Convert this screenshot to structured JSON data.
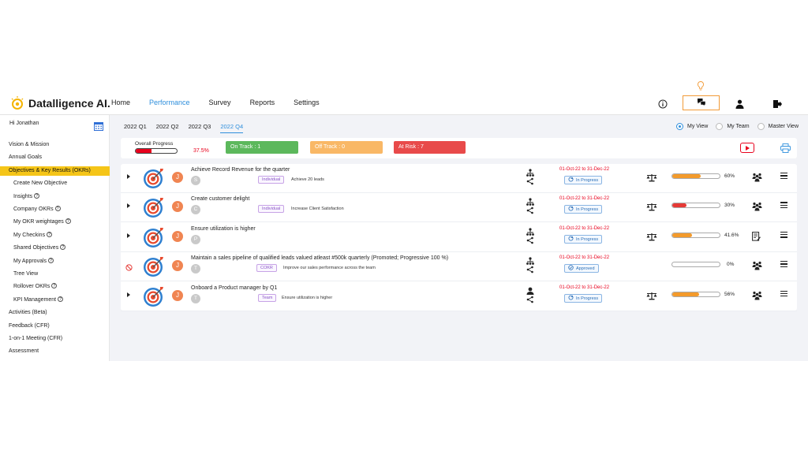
{
  "app": {
    "brand": "Datalligence AI.",
    "nav": [
      "Home",
      "Performance",
      "Survey",
      "Reports",
      "Settings"
    ],
    "active_nav": "Performance"
  },
  "sidebar": {
    "greeting": "Hi Jonathan",
    "items": [
      {
        "label": "Vision & Mission",
        "sub": false,
        "help": false,
        "active": false
      },
      {
        "label": "Annual Goals",
        "sub": false,
        "help": false,
        "active": false
      },
      {
        "label": "Objectives & Key Results (OKRs)",
        "sub": false,
        "help": false,
        "active": true
      },
      {
        "label": "Create New Objective",
        "sub": true,
        "help": false,
        "active": false
      },
      {
        "label": "Insights",
        "sub": true,
        "help": true,
        "active": false
      },
      {
        "label": "Company OKRs",
        "sub": true,
        "help": true,
        "active": false
      },
      {
        "label": "My OKR weightages",
        "sub": true,
        "help": true,
        "active": false
      },
      {
        "label": "My Checkins",
        "sub": true,
        "help": true,
        "active": false
      },
      {
        "label": "Shared Objectives",
        "sub": true,
        "help": true,
        "active": false
      },
      {
        "label": "My Approvals",
        "sub": true,
        "help": true,
        "active": false
      },
      {
        "label": "Tree View",
        "sub": true,
        "help": false,
        "active": false
      },
      {
        "label": "Rollover OKRs",
        "sub": true,
        "help": true,
        "active": false
      },
      {
        "label": "KPI Management",
        "sub": true,
        "help": true,
        "active": false
      },
      {
        "label": "Activities (Beta)",
        "sub": false,
        "help": false,
        "active": false
      },
      {
        "label": "Feedback (CFR)",
        "sub": false,
        "help": false,
        "active": false
      },
      {
        "label": "1-on-1 Meeting (CFR)",
        "sub": false,
        "help": false,
        "active": false
      },
      {
        "label": "Assessment",
        "sub": false,
        "help": false,
        "active": false
      }
    ]
  },
  "quarters": [
    "2022 Q1",
    "2022 Q2",
    "2022 Q3",
    "2022 Q4"
  ],
  "active_quarter": "2022 Q4",
  "views": [
    {
      "label": "My View",
      "selected": true
    },
    {
      "label": "My Team",
      "selected": false
    },
    {
      "label": "Master View",
      "selected": false
    }
  ],
  "summary": {
    "overall_label": "Overall Progress",
    "overall_percent": "37.5%",
    "overall_value": 37.5,
    "on_track": "On Track : 1",
    "off_track": "Off Track : 0",
    "at_risk": "At Risk : 7"
  },
  "colors": {
    "accent": "#2f8fdc",
    "sidebar_active": "#f5c518",
    "on_track": "#5cb85c",
    "off_track": "#f9b866",
    "at_risk": "#e84a4a",
    "orange_progress": "#f39a2b",
    "red_progress": "#e53935"
  },
  "okrs": [
    {
      "title": "Achieve Record Revenue for the quarter",
      "owner_initial": "J",
      "sub_initial": "S",
      "tag": "Individual",
      "key_result": "Achieve 20 leads",
      "dates": "01-Oct-22 to 31-Dec-22",
      "status": "In Progress",
      "progress": 60,
      "progress_label": "60%",
      "bar_color": "#f39a2b",
      "blocked": false,
      "tree_icon": "org-tree-icon",
      "action_icon": "balance-scale-icon",
      "team_icon": "team-icon"
    },
    {
      "title": "Create customer delight",
      "owner_initial": "J",
      "sub_initial": "C",
      "tag": "Individual",
      "key_result": "Increase Client Satisfaction",
      "dates": "01-Oct-22 to 31-Dec-22",
      "status": "In Progress",
      "progress": 30,
      "progress_label": "30%",
      "bar_color": "#e53935",
      "blocked": false,
      "tree_icon": "org-tree-icon",
      "action_icon": "balance-scale-icon",
      "team_icon": "team-icon"
    },
    {
      "title": "Ensure utilization is higher",
      "owner_initial": "J",
      "sub_initial": "P",
      "tag": "",
      "key_result": "",
      "dates": "01-Oct-22 to 31-Dec-22",
      "status": "In Progress",
      "progress": 41.6,
      "progress_label": "41.6%",
      "bar_color": "#f39a2b",
      "blocked": false,
      "tree_icon": "org-tree-icon",
      "action_icon": "balance-scale-icon",
      "team_icon": "notes-icon"
    },
    {
      "title": "Maintain a sales pipeline of qualified leads valued atleast #500k quarterly (Promoted; Progressive 100 %)",
      "owner_initial": "J",
      "sub_initial": "T",
      "tag": "COKR",
      "key_result": "Improve our sales performance across the team",
      "dates": "01-Oct-22 to 31-Dec-22",
      "status": "Approved",
      "progress": 0,
      "progress_label": "0%",
      "bar_color": "#f39a2b",
      "blocked": true,
      "tree_icon": "org-tree-icon",
      "action_icon": "",
      "team_icon": "team-icon"
    },
    {
      "title": "Onboard a Product manager by Q1",
      "owner_initial": "J",
      "sub_initial": "T",
      "tag": "Team",
      "key_result": "Ensure utilization is higher",
      "dates": "01-Oct-22 to 31-Dec-22",
      "status": "In Progress",
      "progress": 56,
      "progress_label": "56%",
      "bar_color": "#f39a2b",
      "blocked": false,
      "tree_icon": "person-share-icon",
      "action_icon": "balance-scale-icon",
      "team_icon": "team-icon"
    }
  ]
}
